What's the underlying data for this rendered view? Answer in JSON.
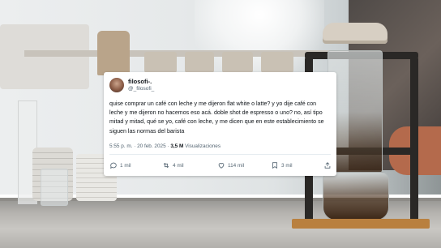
{
  "tweet": {
    "display_name": "filosofi-.",
    "handle": "@_filosofi_",
    "text": "quise comprar un café con leche y me dijeron flat white o latte? y yo dije café con leche y me dijeron no hacemos eso acá. doble shot de espresso o uno? no, así tipo mitad y mitad, qué se yo, café con leche, y me dicen que en este establecimiento se siguen las normas del barista",
    "time_date": "5:55 p. m. · 20 feb. 2025 ·",
    "views_count": "3,5 M",
    "views_label": "Visualizaciones",
    "replies": "1 mil",
    "retweets": "4 mil",
    "likes": "114 mil",
    "bookmarks": "3 mil"
  },
  "icons": {
    "reply": "speech-bubble-icon",
    "retweet": "retweet-icon",
    "like": "heart-icon",
    "bookmark": "bookmark-icon",
    "share": "share-icon"
  },
  "colors": {
    "card_bg": "#ffffff",
    "text_primary": "#0f1419",
    "text_secondary": "#536471"
  }
}
